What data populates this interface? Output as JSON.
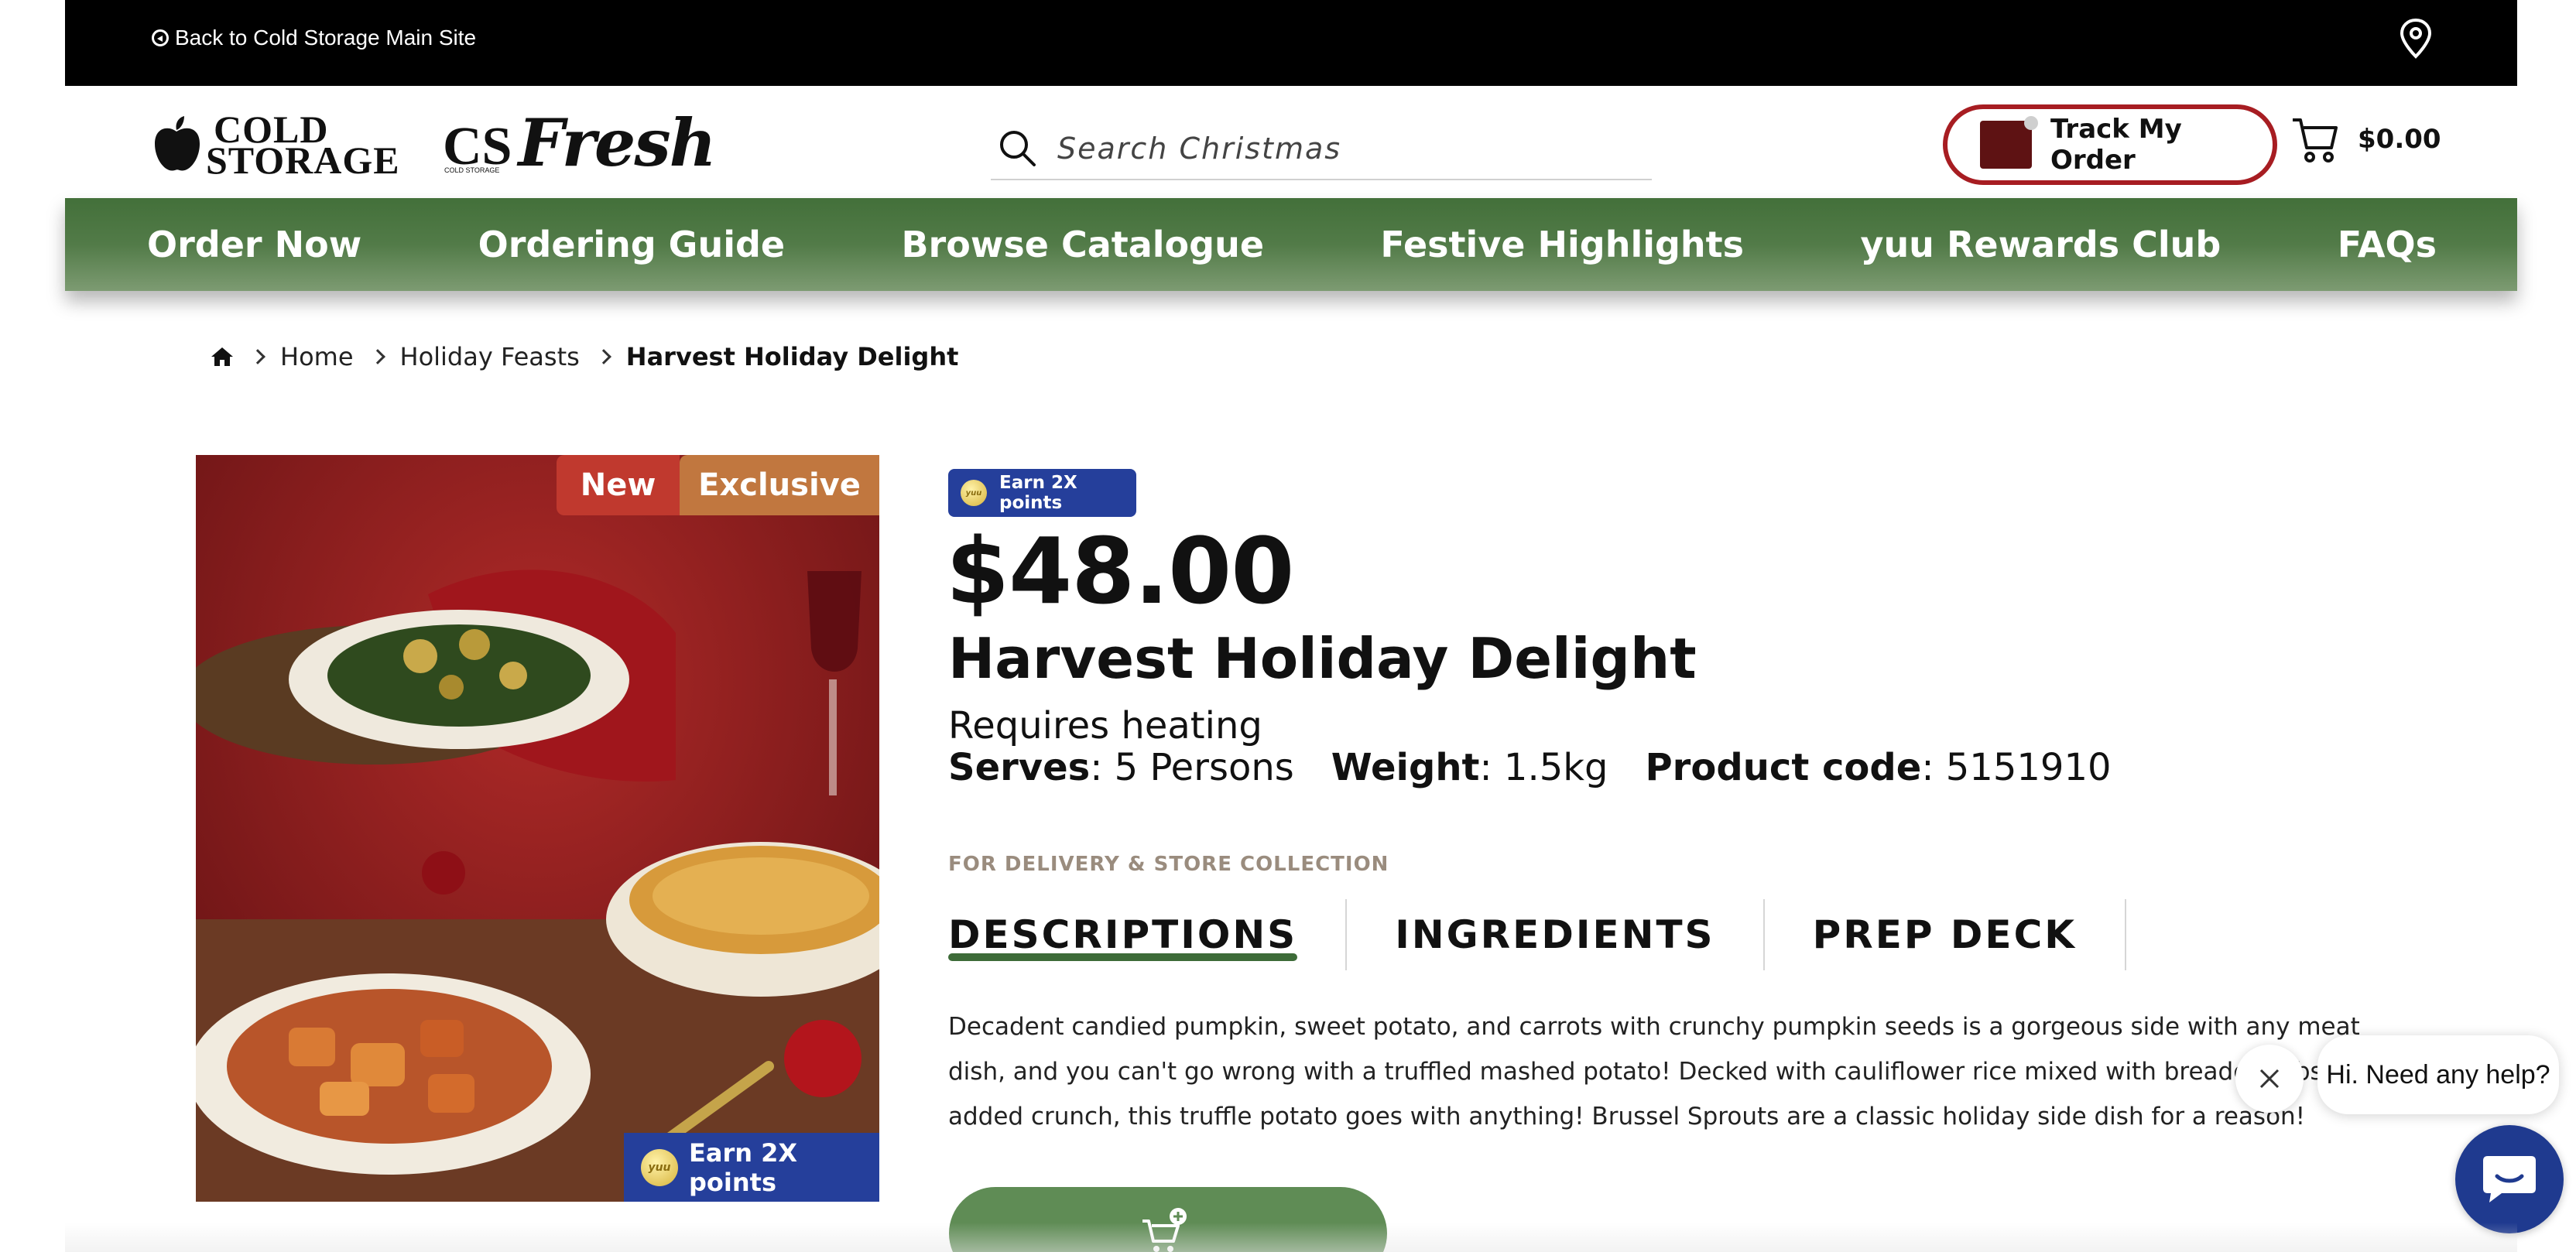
{
  "topbar": {
    "back_link": "Back to Cold Storage Main Site",
    "location_icon": "location-pin-icon"
  },
  "header": {
    "logo_cold_line1": "COLD",
    "logo_cold_line2": "STORAGE",
    "logo_cs": "CS",
    "logo_fresh": "Fresh",
    "logo_small": "COLD STORAGE",
    "search_placeholder": "Search Christmas",
    "track_order_label": "Track My Order",
    "cart_amount": "$0.00"
  },
  "nav": {
    "items": [
      "Order Now",
      "Ordering Guide",
      "Browse Catalogue",
      "Festive Highlights",
      "yuu Rewards Club",
      "FAQs"
    ]
  },
  "breadcrumb": {
    "items": [
      "Home",
      "Holiday Feasts",
      "Harvest Holiday Delight"
    ]
  },
  "product": {
    "badges": {
      "new": "New",
      "exclusive": "Exclusive"
    },
    "earn_points": "Earn 2X points",
    "yuu_coin": "yuu",
    "price": "$48.00",
    "title": "Harvest Holiday Delight",
    "heating": "Requires heating",
    "serves_label": "Serves",
    "serves_value": ": 5 Persons",
    "weight_label": "Weight",
    "weight_value": ": 1.5kg",
    "code_label": "Product code",
    "code_value": ": 5151910",
    "delivery_note": "FOR DELIVERY & STORE COLLECTION",
    "tabs": [
      "DESCRIPTIONS",
      "INGREDIENTS",
      "PREP DECK"
    ],
    "description": "Decadent candied pumpkin, sweet potato, and carrots with crunchy pumpkin seeds is a gorgeous side with any meat dish, and you can't go wrong with a truffled mashed potato! Decked with cauliflower rice mixed with breadcrumbs for added crunch, this truffle potato goes with anything! Brussel Sprouts are a classic holiday side dish for a reason!"
  },
  "chat": {
    "greeting": "Hi. Need any help?"
  },
  "colors": {
    "nav_green": "#527b48",
    "track_red": "#a71d22",
    "badge_new": "#c0392e",
    "badge_exclusive": "#c1773f",
    "yuu_blue": "#253f9b",
    "chat_blue": "#1f3a8f"
  }
}
